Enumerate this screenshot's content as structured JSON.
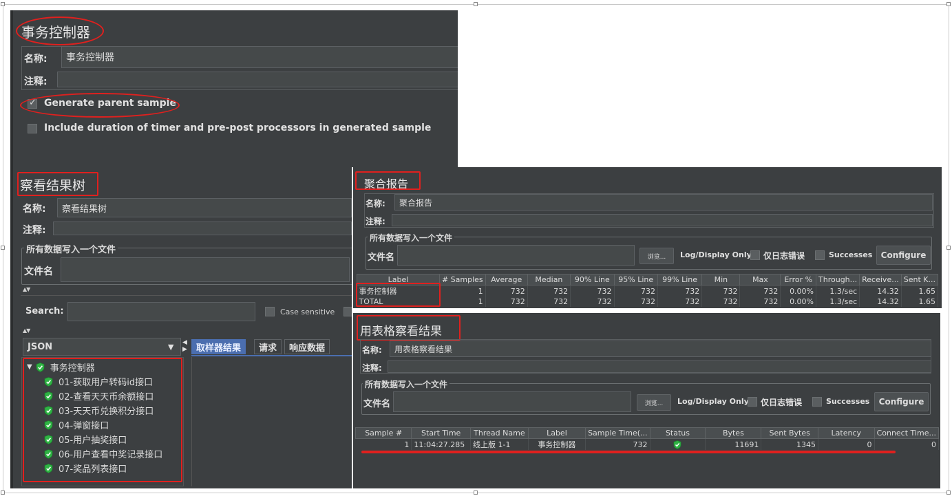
{
  "tc": {
    "title": "事务控制器",
    "name_label": "名称:",
    "name_value": "事务控制器",
    "comment_label": "注释:",
    "generate_parent": "Generate parent sample",
    "include_duration": "Include duration of timer and pre-post processors in generated sample"
  },
  "vrt": {
    "title": "察看结果树",
    "name_label": "名称:",
    "name_value": "察看结果树",
    "comment_label": "注释:",
    "group_title": "所有数据写入一个文件",
    "file_label": "文件名",
    "search_label": "Search:",
    "case_sensitive": "Case sensitive",
    "renderer": "JSON",
    "tabs": [
      "取样器结果",
      "请求",
      "响应数据"
    ],
    "tree_root": "事务控制器",
    "tree_children": [
      "01-获取用户转码id接口",
      "02-查看天天币余额接口",
      "03-天天币兑换积分接口",
      "04-弹窗接口",
      "05-用户抽奖接口",
      "06-用户查看中奖记录接口",
      "07-奖品列表接口"
    ]
  },
  "agg": {
    "title": "聚合报告",
    "name_label": "名称:",
    "name_value": "聚合报告",
    "comment_label": "注释:",
    "group_title": "所有数据写入一个文件",
    "file_label": "文件名",
    "browse": "浏览...",
    "log_display": "Log/Display Only:",
    "errors_only": "仅日志错误",
    "successes": "Successes",
    "configure": "Configure",
    "columns": [
      "Label",
      "# Samples",
      "Average",
      "Median",
      "90% Line",
      "95% Line",
      "99% Line",
      "Min",
      "Max",
      "Error %",
      "Through...",
      "Receive...",
      "Sent K..."
    ],
    "rows": [
      [
        "事务控制器",
        "1",
        "732",
        "732",
        "732",
        "732",
        "732",
        "732",
        "732",
        "0.00%",
        "1.3/sec",
        "14.32",
        "1.65"
      ],
      [
        "TOTAL",
        "1",
        "732",
        "732",
        "732",
        "732",
        "732",
        "732",
        "732",
        "0.00%",
        "1.3/sec",
        "14.32",
        "1.65"
      ]
    ]
  },
  "tbl": {
    "title": "用表格察看结果",
    "name_label": "名称:",
    "name_value": "用表格察看结果",
    "comment_label": "注释:",
    "group_title": "所有数据写入一个文件",
    "file_label": "文件名",
    "browse": "浏览...",
    "log_display": "Log/Display Only:",
    "errors_only": "仅日志错误",
    "successes": "Successes",
    "configure": "Configure",
    "columns": [
      "Sample #",
      "Start Time",
      "Thread Name",
      "Label",
      "Sample Time(...",
      "Status",
      "Bytes",
      "Sent Bytes",
      "Latency",
      "Connect Time..."
    ],
    "row": [
      "1",
      "11:04:27.285",
      "线上版 1-1",
      "事务控制器",
      "732",
      "",
      "11691",
      "1345",
      "0",
      "0"
    ]
  },
  "colors": {
    "panel": "#3c3f41",
    "highlight": "#e0201e",
    "tab_active": "#4b6eaf",
    "success_green": "#2fb344"
  }
}
